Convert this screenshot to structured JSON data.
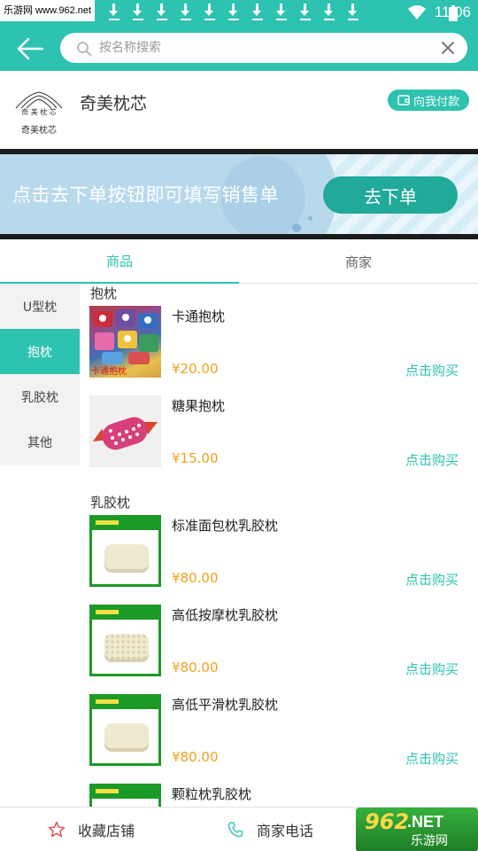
{
  "status_bar": {
    "watermark": "乐游网 www.962.net",
    "time": "11:06",
    "download_count": 11
  },
  "header": {
    "search_placeholder": "按名称搜索"
  },
  "store": {
    "logo_text": "奇美枕芯",
    "logo_small": "奇 美 枕 芯",
    "name": "奇美枕芯",
    "pay_label": "向我付款"
  },
  "banner": {
    "text": "点击去下单按钮即可填写销售单",
    "button": "去下单"
  },
  "tabs": [
    {
      "label": "商品",
      "active": true
    },
    {
      "label": "商家",
      "active": false
    }
  ],
  "categories": [
    {
      "label": "U型枕",
      "active": false
    },
    {
      "label": "抱枕",
      "active": true
    },
    {
      "label": "乳胶枕",
      "active": false
    },
    {
      "label": "其他",
      "active": false
    }
  ],
  "sections": [
    {
      "title": "抱枕",
      "items": [
        {
          "name": "卡通抱枕",
          "price": "¥20.00",
          "action": "点击购买",
          "thumb_caption": "卡通抱枕"
        },
        {
          "name": "糖果抱枕",
          "price": "¥15.00",
          "action": "点击购买"
        }
      ]
    },
    {
      "title": "乳胶枕",
      "items": [
        {
          "name": "标准面包枕乳胶枕",
          "price": "¥80.00",
          "action": "点击购买"
        },
        {
          "name": "高低按摩枕乳胶枕",
          "price": "¥80.00",
          "action": "点击购买"
        },
        {
          "name": "高低平滑枕乳胶枕",
          "price": "¥80.00",
          "action": "点击购买"
        },
        {
          "name": "颗粒枕乳胶枕",
          "price": "",
          "action": ""
        }
      ]
    }
  ],
  "bottom_bar": {
    "favorite_label": "收藏店铺",
    "phone_label": "商家电话"
  },
  "watermark_br": {
    "big": "962",
    "net": ".NET",
    "small": "乐游网"
  },
  "colors": {
    "accent": "#2ec2b0",
    "price": "#f0a21c"
  }
}
